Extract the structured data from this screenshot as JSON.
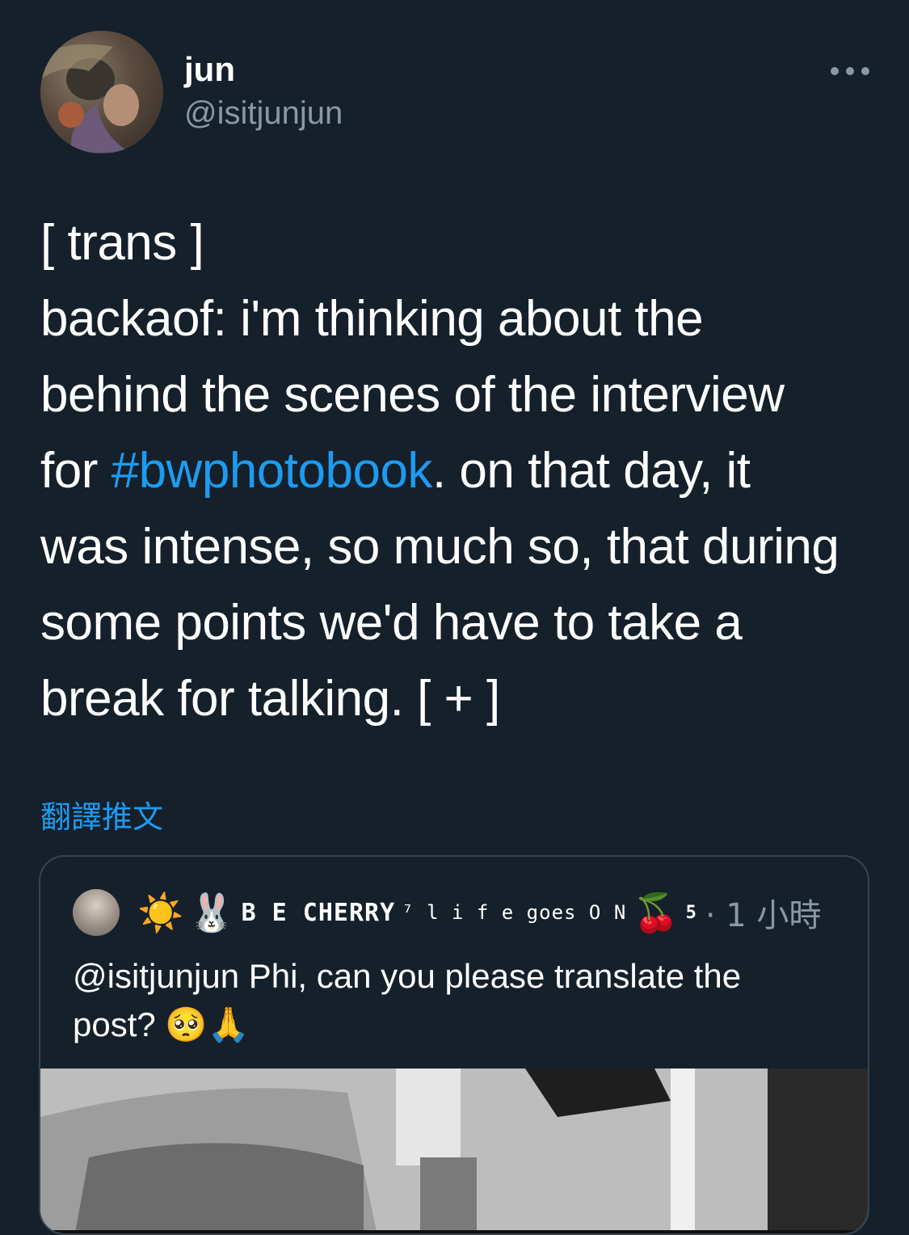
{
  "author": {
    "display_name": "jun",
    "handle": "@isitjunjun"
  },
  "tweet": {
    "lines": [
      "[ trans ]",
      "backaof: i'm thinking about the",
      "behind the scenes of the interview",
      "for ",
      "#bwphotobook",
      ".  on that day, it",
      "was intense, so much so, that during",
      "some points we'd have to take a",
      "break for talking. [ + ]"
    ]
  },
  "translate_label": "翻譯推文",
  "quoted": {
    "name": "B E CHERRY⁷ l i f e goes O N",
    "name_parts": [
      "☀️",
      "🐰",
      "B E CHERRY",
      "⁷ l i f e goes O N",
      "🍒",
      "5"
    ],
    "time": "· 1 小時",
    "text_line1": "@isitjunjun Phi, can you please translate the",
    "text_line2": "post? 🥺🙏"
  },
  "icons": {
    "more": "more-horizontal-icon"
  },
  "colors": {
    "background": "#15202b",
    "link": "#1d9bf0",
    "secondary_text": "#8899a6",
    "border": "#38444d"
  }
}
